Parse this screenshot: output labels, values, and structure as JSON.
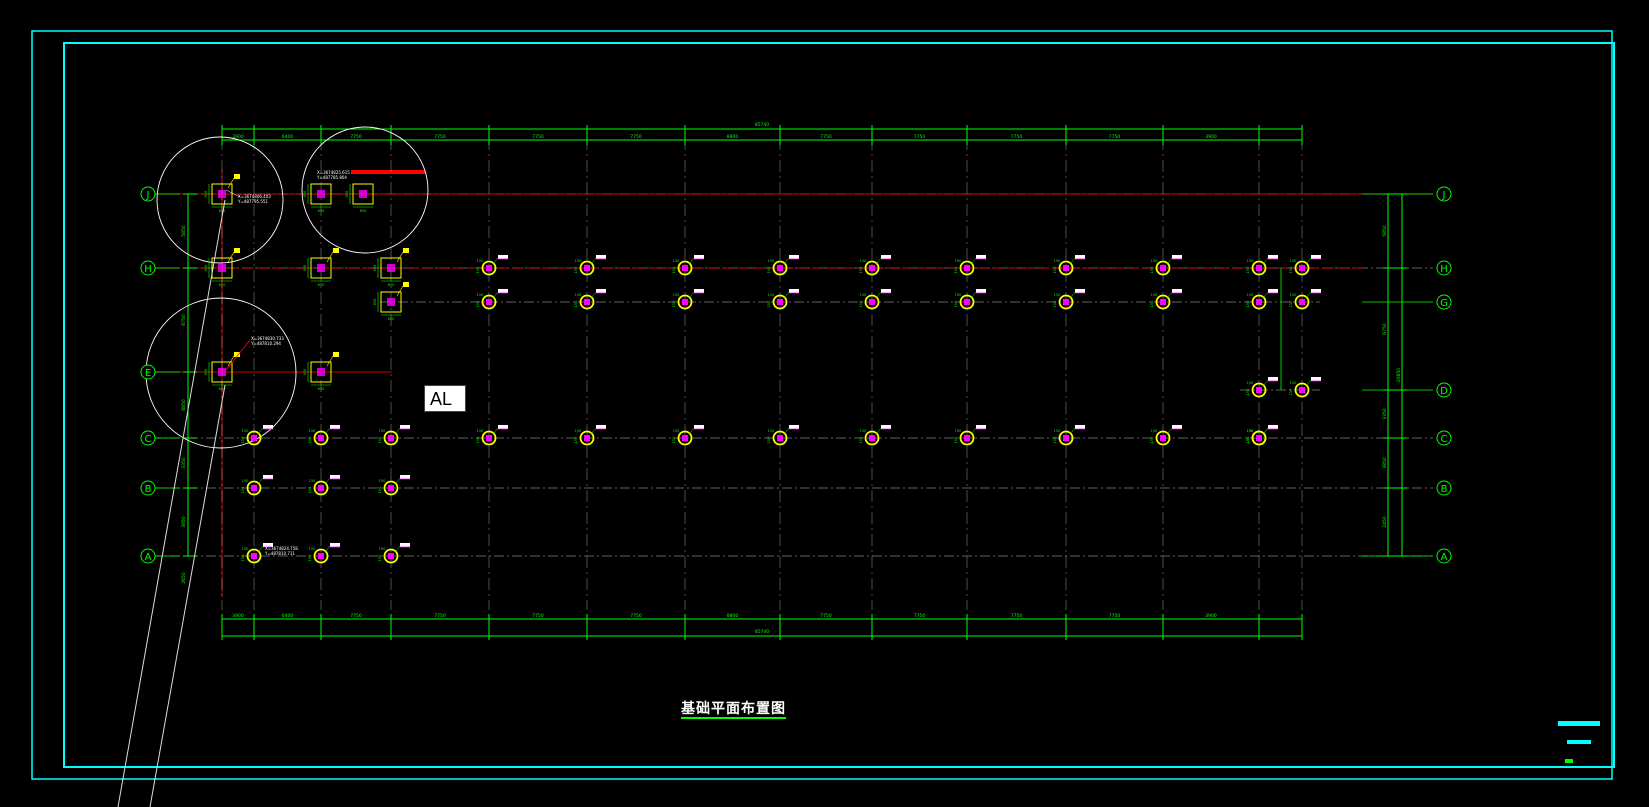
{
  "drawing": {
    "title": "基础平面布置图",
    "cursor_tooltip": "AL"
  },
  "axes": {
    "rows": [
      "J",
      "H",
      "G",
      "E",
      "D",
      "C",
      "B",
      "A"
    ],
    "top_spacing_labels": [
      "3900",
      "6400",
      "7750",
      "7750",
      "7750",
      "7750",
      "8800",
      "7750",
      "7750",
      "7750",
      "7750",
      "3900"
    ],
    "total_length": "85740",
    "left_spacing_labels": [
      "5850",
      "8750",
      "8850",
      "3350",
      "3850",
      "2650"
    ],
    "right_spacing_labels": [
      "5850",
      "6750",
      "3350",
      "3850",
      "2450"
    ],
    "right_total": "20850"
  },
  "coordinates": {
    "j_left": [
      "X=3674806.403",
      "Y=487795.551"
    ],
    "j_mid": [
      "X=3674825.615",
      "Y=487785.804"
    ],
    "e_left": [
      "X=3674830.733",
      "Y=487810.294"
    ],
    "a_left": [
      "X=3674824.758",
      "Y=487810.711"
    ]
  },
  "footings": {
    "square_dims": [
      "650",
      "650"
    ],
    "pile_label": "150"
  },
  "colors": {
    "background": "#000000",
    "frame": "#00ffff",
    "grid": "#ffffff",
    "axis": "#ff0000",
    "dimension": "#00ff00",
    "footing": "#ffff00",
    "pile": "#ff00ff",
    "tag": "#ffffff"
  }
}
